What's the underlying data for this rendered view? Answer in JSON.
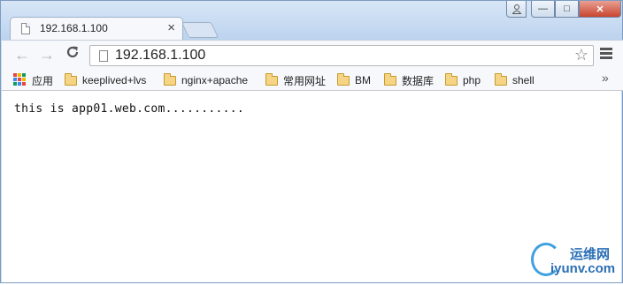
{
  "tab": {
    "title": "192.168.1.100",
    "close": "×"
  },
  "window_controls": {
    "minimize": "—",
    "maximize": "□",
    "close": "✕"
  },
  "toolbar": {
    "back": "←",
    "forward": "→",
    "reload": "C",
    "url": "192.168.1.100",
    "star": "☆"
  },
  "bookmarks": {
    "apps_label": "应用",
    "items": [
      {
        "label": "keeplived+lvs"
      },
      {
        "label": "nginx+apache"
      },
      {
        "label": "常用网址"
      },
      {
        "label": "BM"
      },
      {
        "label": "数据库"
      },
      {
        "label": "php"
      },
      {
        "label": "shell"
      }
    ],
    "more": "»"
  },
  "page": {
    "body_text": "this is app01.web.com..........."
  },
  "watermark": {
    "cn": "运维网",
    "en": "iyunv.com"
  },
  "colors": {
    "apps_grid": [
      "#e8453c",
      "#f4b400",
      "#0f9d58",
      "#4285f4",
      "#e8453c",
      "#f4b400",
      "#0f9d58",
      "#4285f4",
      "#e8453c"
    ]
  }
}
